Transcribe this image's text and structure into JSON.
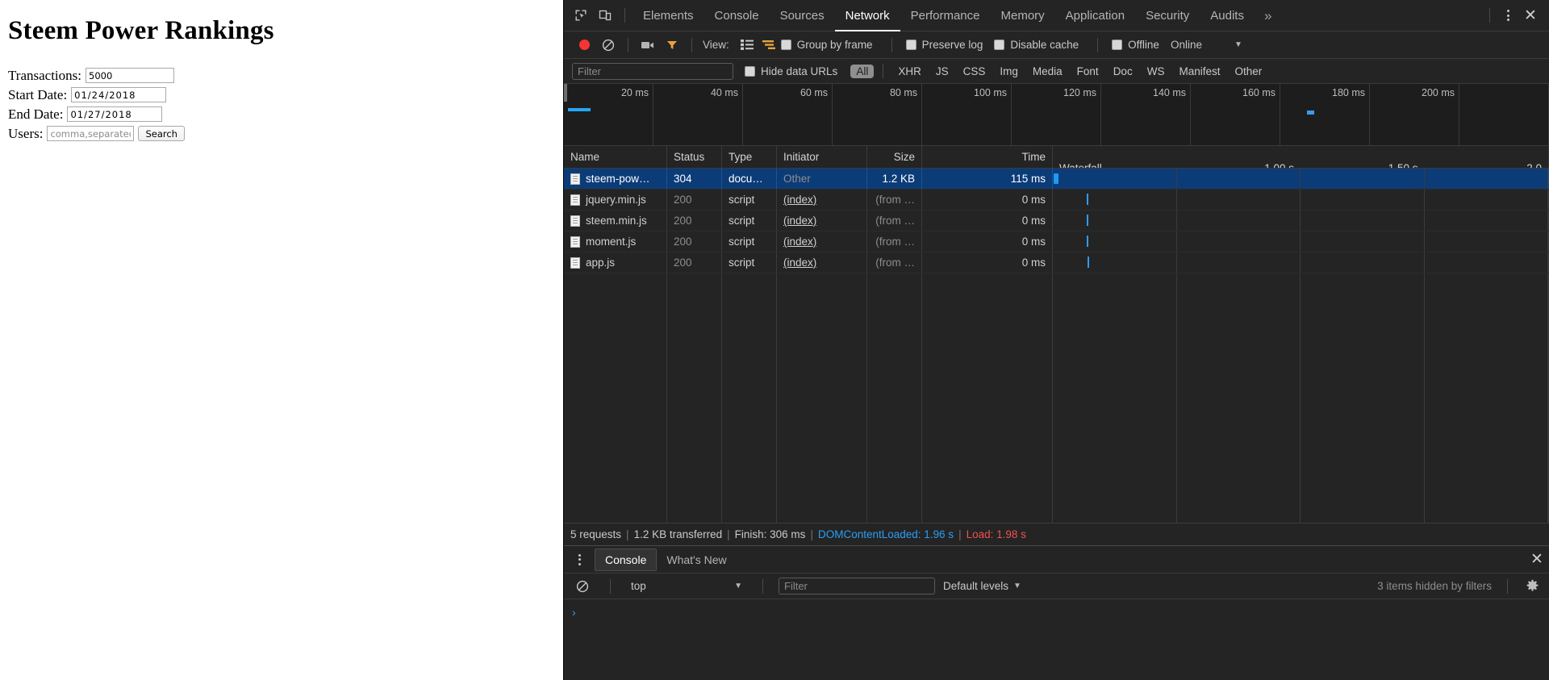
{
  "page": {
    "title": "Steem Power Rankings",
    "fields": [
      {
        "label": "Transactions:",
        "value": "5000",
        "placeholder": "",
        "kind": "num"
      },
      {
        "label": "Start Date:",
        "value": "01/24/2018",
        "placeholder": "",
        "kind": "date"
      },
      {
        "label": "End Date:",
        "value": "01/27/2018",
        "placeholder": "",
        "kind": "date"
      },
      {
        "label": "Users:",
        "value": "",
        "placeholder": "comma,separated,name",
        "kind": "users"
      }
    ],
    "search_button": "Search"
  },
  "devtools": {
    "tabs": [
      {
        "label": "Elements",
        "active": false
      },
      {
        "label": "Console",
        "active": false
      },
      {
        "label": "Sources",
        "active": false
      },
      {
        "label": "Network",
        "active": true
      },
      {
        "label": "Performance",
        "active": false
      },
      {
        "label": "Memory",
        "active": false
      },
      {
        "label": "Application",
        "active": false
      },
      {
        "label": "Security",
        "active": false
      },
      {
        "label": "Audits",
        "active": false
      }
    ],
    "more_tabs_label": "»",
    "close_label": "✕",
    "icons": {
      "inspect": "inspect-element-icon",
      "device": "device-toolbar-icon",
      "record": "record-icon",
      "clear": "clear-icon",
      "camera": "capture-screenshots-icon",
      "filter": "filter-icon",
      "kebab": "more-options-icon"
    },
    "toolbar": {
      "view_label": "View:",
      "group_by_frame": "Group by frame",
      "preserve_log": "Preserve log",
      "disable_cache": "Disable cache",
      "offline": "Offline",
      "throttle_value": "Online"
    },
    "filter_bar": {
      "filter_placeholder": "Filter",
      "filter_value": "",
      "hide_data_urls": "Hide data URLs",
      "resource_types": [
        {
          "label": "All",
          "selected": true
        },
        {
          "label": "XHR",
          "selected": false
        },
        {
          "label": "JS",
          "selected": false
        },
        {
          "label": "CSS",
          "selected": false
        },
        {
          "label": "Img",
          "selected": false
        },
        {
          "label": "Media",
          "selected": false
        },
        {
          "label": "Font",
          "selected": false
        },
        {
          "label": "Doc",
          "selected": false
        },
        {
          "label": "WS",
          "selected": false
        },
        {
          "label": "Manifest",
          "selected": false
        },
        {
          "label": "Other",
          "selected": false
        }
      ]
    },
    "overview": {
      "ticks": [
        "20 ms",
        "40 ms",
        "60 ms",
        "80 ms",
        "100 ms",
        "120 ms",
        "140 ms",
        "160 ms",
        "180 ms",
        "200 ms",
        ""
      ]
    },
    "table": {
      "columns": [
        "Name",
        "Status",
        "Type",
        "Initiator",
        "Size",
        "Time",
        "Waterfall"
      ],
      "waterfall_ticks": [
        "Waterfall",
        "1.00 s",
        "1.50 s",
        "2.0"
      ],
      "rows": [
        {
          "name": "steem-pow…",
          "status": "304",
          "type": "docu…",
          "initiator": "Other",
          "initiator_link": false,
          "size": "1.2 KB",
          "time": "115 ms",
          "selected": true,
          "bar_left_pct": 0.3,
          "bar_width_pct": 1.1
        },
        {
          "name": "jquery.min.js",
          "status": "200",
          "type": "script",
          "initiator": "(index)",
          "initiator_link": true,
          "size": "(from …",
          "time": "0 ms",
          "selected": false,
          "bar_left_pct": 11.0,
          "bar_width_pct": 0.35
        },
        {
          "name": "steem.min.js",
          "status": "200",
          "type": "script",
          "initiator": "(index)",
          "initiator_link": true,
          "size": "(from …",
          "time": "0 ms",
          "selected": false,
          "bar_left_pct": 11.0,
          "bar_width_pct": 0.35
        },
        {
          "name": "moment.js",
          "status": "200",
          "type": "script",
          "initiator": "(index)",
          "initiator_link": true,
          "size": "(from …",
          "time": "0 ms",
          "selected": false,
          "bar_left_pct": 11.0,
          "bar_width_pct": 0.35
        },
        {
          "name": "app.js",
          "status": "200",
          "type": "script",
          "initiator": "(index)",
          "initiator_link": true,
          "size": "(from …",
          "time": "0 ms",
          "selected": false,
          "bar_left_pct": 11.2,
          "bar_width_pct": 0.35
        }
      ]
    },
    "status_bar": {
      "requests": "5 requests",
      "transferred": "1.2 KB transferred",
      "finish": "Finish: 306 ms",
      "dom_content_loaded": "DOMContentLoaded: 1.96 s",
      "load": "Load: 1.98 s",
      "separator": "|"
    },
    "drawer": {
      "tabs": [
        {
          "label": "Console",
          "active": true
        },
        {
          "label": "What's New",
          "active": false
        }
      ],
      "close_label": "✕",
      "context": "top",
      "filter_placeholder": "Filter",
      "filter_value": "",
      "levels": "Default levels",
      "hidden_items": "3 items hidden by filters",
      "prompt": "›"
    }
  },
  "colors": {
    "accent_blue": "#2b9ef5",
    "error_red": "#f15050",
    "selected_row": "#0b3c78",
    "record_red": "#f73434",
    "filter_orange": "#e8a33d",
    "devtools_bg": "#242424"
  }
}
